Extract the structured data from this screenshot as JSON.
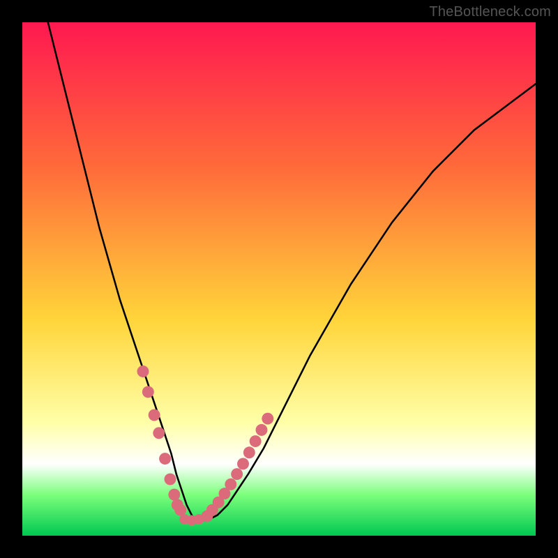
{
  "watermark": "TheBottleneck.com",
  "colors": {
    "black": "#000000",
    "curve": "#000000",
    "dots": "#db6b7b",
    "grad_top": "#ff1850",
    "grad_mid1": "#ff6a3a",
    "grad_mid2": "#ffd53a",
    "grad_pale": "#ffffa8",
    "grad_white": "#ffffff",
    "grad_green1": "#7cff7c",
    "grad_green2": "#00c851"
  },
  "chart_data": {
    "type": "line",
    "title": "",
    "xlabel": "",
    "ylabel": "",
    "xlim": [
      0,
      100
    ],
    "ylim": [
      0,
      100
    ],
    "curve": {
      "x": [
        5,
        7,
        9,
        11,
        13,
        15,
        17,
        19,
        21,
        23,
        25,
        27,
        29,
        30,
        31,
        32,
        33,
        34,
        36,
        38,
        40,
        42,
        44,
        47,
        50,
        53,
        56,
        60,
        64,
        68,
        72,
        76,
        80,
        84,
        88,
        92,
        96,
        100
      ],
      "y": [
        100,
        92,
        84,
        76,
        68,
        60,
        53,
        46,
        40,
        34,
        28,
        22,
        16,
        12,
        9,
        6,
        4,
        3,
        3,
        4,
        6,
        9,
        12,
        17,
        23,
        29,
        35,
        42,
        49,
        55,
        61,
        66,
        71,
        75,
        79,
        82,
        85,
        88
      ]
    },
    "dots": {
      "left_branch_x": [
        23.5,
        24.5,
        25.7,
        26.6,
        27.8,
        28.8,
        29.6,
        30.2,
        30.8
      ],
      "left_branch_y": [
        32,
        28,
        23.5,
        20,
        15,
        11,
        8,
        6,
        5
      ],
      "floor_x": [
        31.6,
        33.0,
        34.4
      ],
      "floor_y": [
        3.2,
        3.0,
        3.2
      ],
      "right_branch_x": [
        36.0,
        37.0,
        38.2,
        39.4,
        40.6,
        41.8,
        43.0,
        44.2,
        45.4,
        46.6,
        47.8
      ],
      "right_branch_y": [
        3.8,
        5.0,
        6.5,
        8.2,
        10.0,
        12.0,
        14.0,
        16.2,
        18.4,
        20.6,
        22.8
      ]
    },
    "legend": [],
    "annotations": []
  }
}
